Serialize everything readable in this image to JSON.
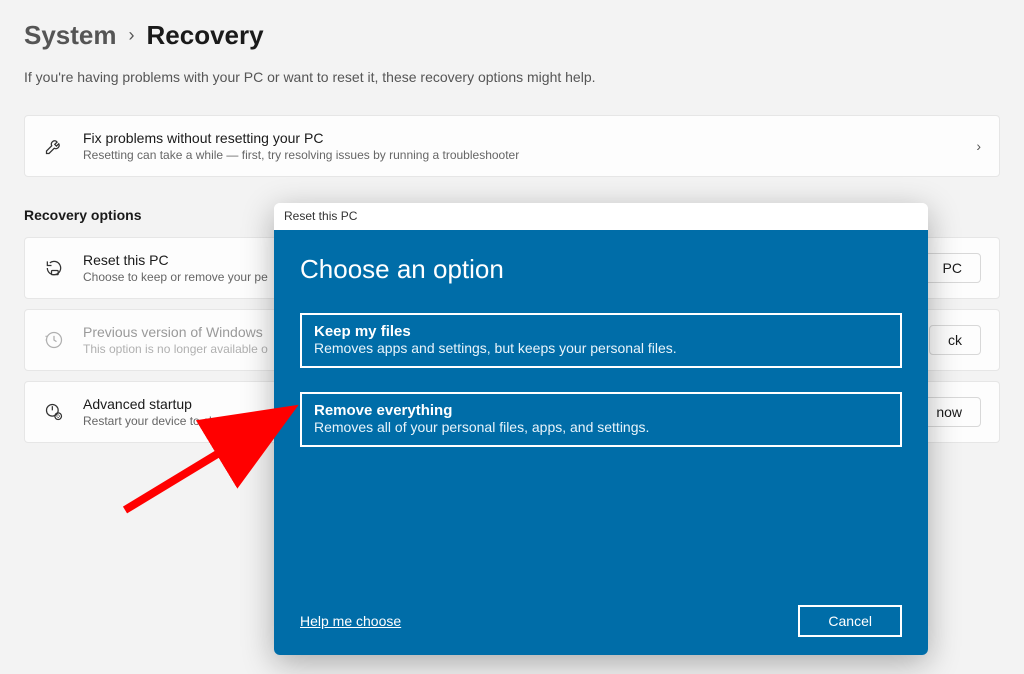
{
  "breadcrumb": {
    "parent": "System",
    "current": "Recovery"
  },
  "subtitle": "If you're having problems with your PC or want to reset it, these recovery options might help.",
  "fix_card": {
    "title": "Fix problems without resetting your PC",
    "desc": "Resetting can take a while — first, try resolving issues by running a troubleshooter"
  },
  "recovery_section_title": "Recovery options",
  "options": {
    "reset": {
      "title": "Reset this PC",
      "desc": "Choose to keep or remove your pe",
      "button": "PC"
    },
    "previous": {
      "title": "Previous version of Windows",
      "desc": "This option is no longer available o",
      "button": "ck"
    },
    "advanced": {
      "title": "Advanced startup",
      "desc": "Restart your device to chang",
      "button": "now"
    }
  },
  "modal": {
    "window_title": "Reset this PC",
    "title": "Choose an option",
    "keep": {
      "title": "Keep my files",
      "desc": "Removes apps and settings, but keeps your personal files."
    },
    "remove": {
      "title": "Remove everything",
      "desc": "Removes all of your personal files, apps, and settings."
    },
    "help": "Help me choose",
    "cancel": "Cancel"
  }
}
